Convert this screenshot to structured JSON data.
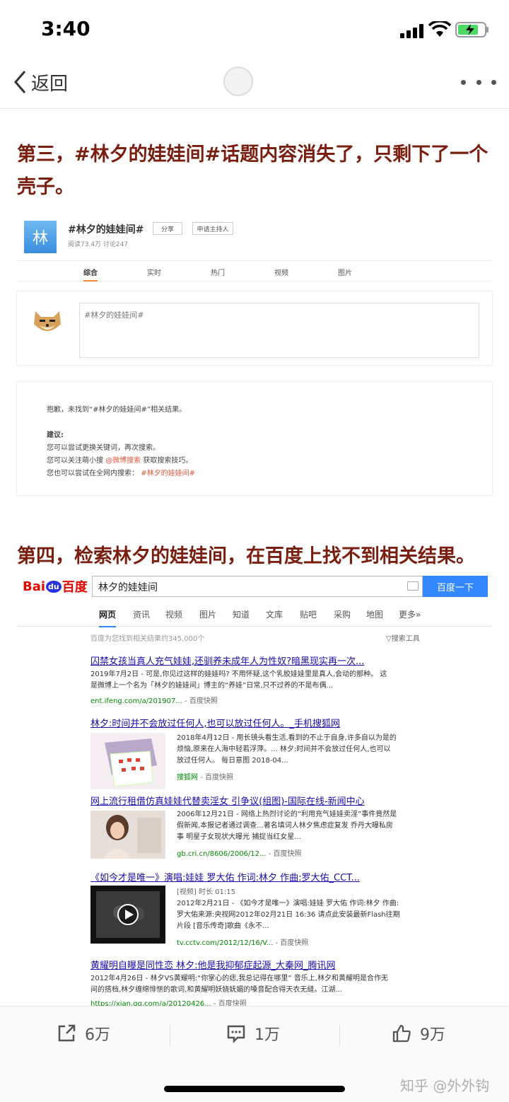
{
  "status": {
    "time": "3:40"
  },
  "nav": {
    "back_label": "返回"
  },
  "article": {
    "heading3_line1": "第三，#林夕的娃娃间#话题内容消失了，只剩下了一个",
    "heading3_line2": "壳子。",
    "heading4": "第四，检索林夕的娃娃间，在百度上找不到相关结果。"
  },
  "weibo": {
    "logo_char": "林",
    "topic": "#林夕的娃娃间#",
    "share_button": "分享",
    "apply_host_button": "申请主持人",
    "stats": "阅读73.4万  讨论247",
    "tabs": [
      "综合",
      "实时",
      "热门",
      "视频",
      "图片"
    ],
    "compose_placeholder": "#林夕的娃娃间#",
    "no_result": "抱歉，未找到“#林夕的娃娃间#”相关结果。",
    "suggest_title": "建议:",
    "suggest_1": "您可以尝试更换关键词，再次搜索。",
    "suggest_2_pre": "您可以关注萌小搜",
    "suggest_2_link": "@微博搜索",
    "suggest_2_post": "获取搜索技巧。",
    "suggest_3_pre": "您也可以尝试在全网内搜索：",
    "suggest_3_link": "#林夕的娃娃间#"
  },
  "baidu": {
    "logo_text_1": "Bai",
    "logo_text_2": "du",
    "logo_text_3": "百度",
    "query": "林夕的娃娃间",
    "search_button": "百度一下",
    "tabs": [
      "网页",
      "资讯",
      "视频",
      "图片",
      "知道",
      "文库",
      "贴吧",
      "采购",
      "地图",
      "更多»"
    ],
    "result_count": "百度为您找到相关结果约345,000个",
    "tools": "▽搜索工具",
    "results": [
      {
        "title": "囚禁女孩当真人充气娃娃,还驯养未成年人为性奴?暗黑现实再一次...",
        "text1": "2019年7月2日 - 可是,你见过这样的娃娃吗? 不用怀疑,这个乳胶娃娃里是真人,会动的那种。 这",
        "text2": "是微博上一个名为「林夕的娃娃间」博主的“养娃”日常,只不过养的不是布偶...",
        "url": "ent.ifeng.com/a/201907...",
        "cache": "- 百度快照"
      },
      {
        "title": "林夕:时间并不会放过任何人,也可以放过任何人。_手机搜狐网",
        "text1": "2018年4月12日 - 用长镜头看生活,看到的不止于自身,许多自以为是的",
        "text2": "烦恼,原来在人海中轻若浮萍。... 林夕:时间并不会放过任何人,也可以",
        "text3": "放过任何人。 每日意图 2018-04...",
        "url": "搜狐网",
        "cache": "- 百度快照"
      },
      {
        "title": "网上流行租借仿真娃娃代替卖淫女 引争议(组图)-国际在线-新闻中心",
        "text1": "2006年12月21日 - 网络上热烈讨论的“利用充气娃娃卖淫”事件竟然是",
        "text2": "假新闻,本报记者通过调查...著名填词人林夕焦虑症复发 乔丹大曝私房",
        "text3": "事 明星子女现状大曝光 捕捉当红女星...",
        "url": "gb.cri.cn/8606/2006/12...",
        "cache": "- 百度快照"
      },
      {
        "title": "《如今才是唯一》演唱:娃娃 罗大佑 作词:林夕 作曲:罗大佑_CCT...",
        "text1": "[视频] 时长 01:15",
        "text2": "2012年2月21日 - 《如今才是唯一》演唱:娃娃 罗大佑 作词:林夕 作曲:",
        "text3": "罗大佑来源:央视网2012年02月21日 16:36 请点此安装最新Flash往期",
        "text4": "片段 [音乐传奇]歌曲《永不...",
        "url": "tv.cctv.com/2012/12/16/V...",
        "cache": "- 百度快照"
      },
      {
        "title": "黄耀明自曝是同性恋 林夕:他是我抑郁症起源_大秦网_腾讯网",
        "text1": "2012年4月26日 - 林夕VS黄耀明:“你掌心的痣,我总记得在哪里” 音乐上,林夕和黄耀明是合作无",
        "text2": "间的搭档,林夕缠绵悱恻的歌词,和黄耀明妖娆妩媚的嗓音配合得天衣无缝。江湖...",
        "url": "https://xian.qq.com/a/20120426...",
        "cache": "- 百度快照"
      }
    ]
  },
  "actions": {
    "share_count": "6万",
    "comment_count": "1万",
    "like_count": "9万"
  },
  "watermark": "知乎 @外外钩"
}
